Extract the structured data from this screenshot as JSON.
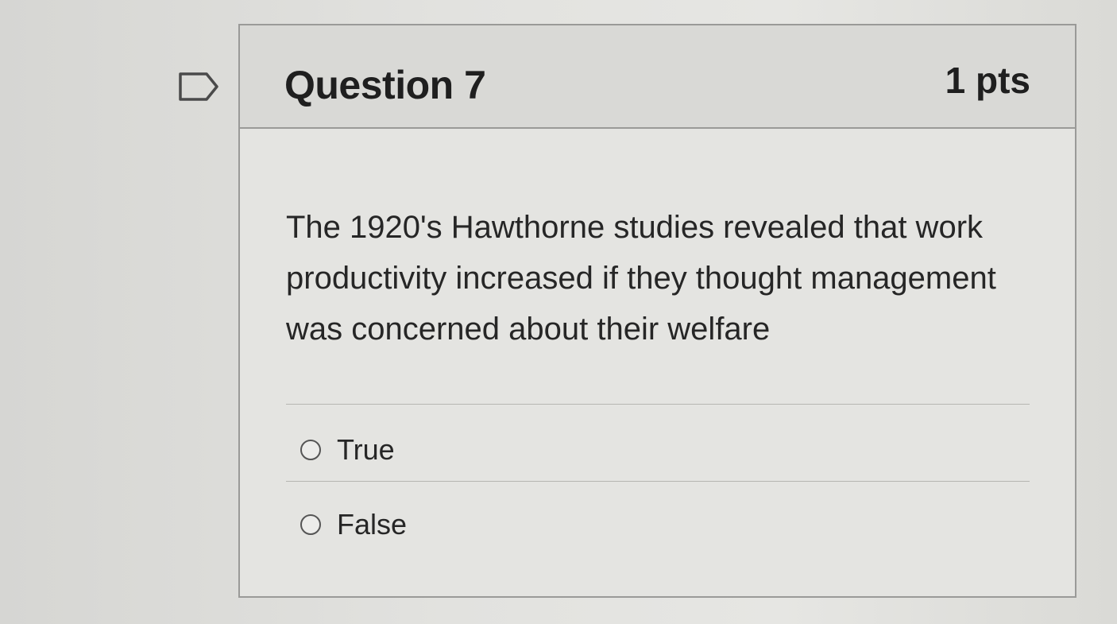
{
  "question": {
    "title": "Question 7",
    "points": "1 pts",
    "text": "The 1920's Hawthorne studies revealed that work productivity increased if they thought management was concerned about their welfare"
  },
  "answers": [
    {
      "label": "True",
      "selected": false
    },
    {
      "label": "False",
      "selected": false
    }
  ],
  "icons": {
    "flag": "flag-question-icon",
    "radio": "radio-button-icon"
  }
}
